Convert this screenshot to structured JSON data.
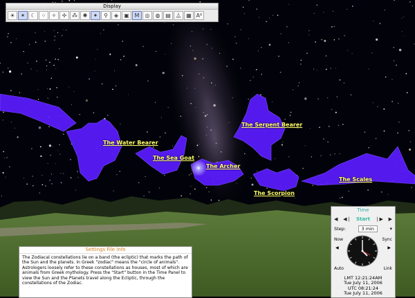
{
  "display_panel": {
    "title": "Display",
    "tools": [
      {
        "icon": "sun-icon",
        "glyph": "☀"
      },
      {
        "icon": "stars-icon",
        "glyph": "✶"
      },
      {
        "icon": "moon-icon",
        "glyph": "☾"
      },
      {
        "icon": "constellation-lines-icon",
        "glyph": "⁘"
      },
      {
        "icon": "comet-icon",
        "glyph": "✧"
      },
      {
        "icon": "star-chart-icon",
        "glyph": "✢"
      },
      {
        "icon": "cluster-icon",
        "glyph": "⁂"
      },
      {
        "icon": "nebula-icon",
        "glyph": "✺"
      },
      {
        "icon": "constellation-figure-icon",
        "glyph": "✦"
      },
      {
        "icon": "magnify-icon",
        "glyph": "⚲"
      },
      {
        "icon": "boundary-icon",
        "glyph": "◈"
      },
      {
        "icon": "image-frame-icon",
        "glyph": "▣"
      },
      {
        "icon": "messier-icon",
        "glyph": "M"
      },
      {
        "icon": "galaxy-icon",
        "glyph": "◎"
      },
      {
        "icon": "planet-icon",
        "glyph": "◍"
      },
      {
        "icon": "landscape-icon",
        "glyph": "▤"
      },
      {
        "icon": "horizon-icon",
        "glyph": "⏅"
      },
      {
        "icon": "grid-icon",
        "glyph": "▦"
      },
      {
        "icon": "labels-icon",
        "glyph": "Aᴮ"
      }
    ]
  },
  "constellation_labels": {
    "water_bearer": "The Water Bearer",
    "sea_goat": "The Sea Goat",
    "serpent_bearer": "The Serpent Bearer",
    "archer": "The Archer",
    "scorpion": "The Scorpion",
    "scales": "The Scales"
  },
  "settings": {
    "title": "Settings File Info",
    "text": "The Zodiacal constellations lie on a band (the ecliptic) that marks the path of the Sun and the planets. In Greek \"zodiac\" means the \"circle of animals\". Astrologers loosely refer to these constellations as houses, most of which are animals from Greek mythology. Press the \"Start\" button in the Time Panel to view the Sun and the Planets travel along the Ecliptic, through the constellations of the Zodiac."
  },
  "time_panel": {
    "title": "Time",
    "start_label": "Start",
    "step_label": "Step:",
    "step_value": "3 min",
    "now_label": "Now",
    "sync_label": "Sync",
    "auto_label": "Auto",
    "link_label": "Link",
    "lmt": "LMT 12:21:24AM",
    "lmt_date": "Tue July 11, 2006",
    "utc": "UTC 08:21:24",
    "utc_date": "Tue July 11, 2006"
  },
  "colors": {
    "constellation_fill": "#5a1cff",
    "label": "#ffff66",
    "time_title": "#2fa8a8",
    "settings_title": "#d08020"
  }
}
